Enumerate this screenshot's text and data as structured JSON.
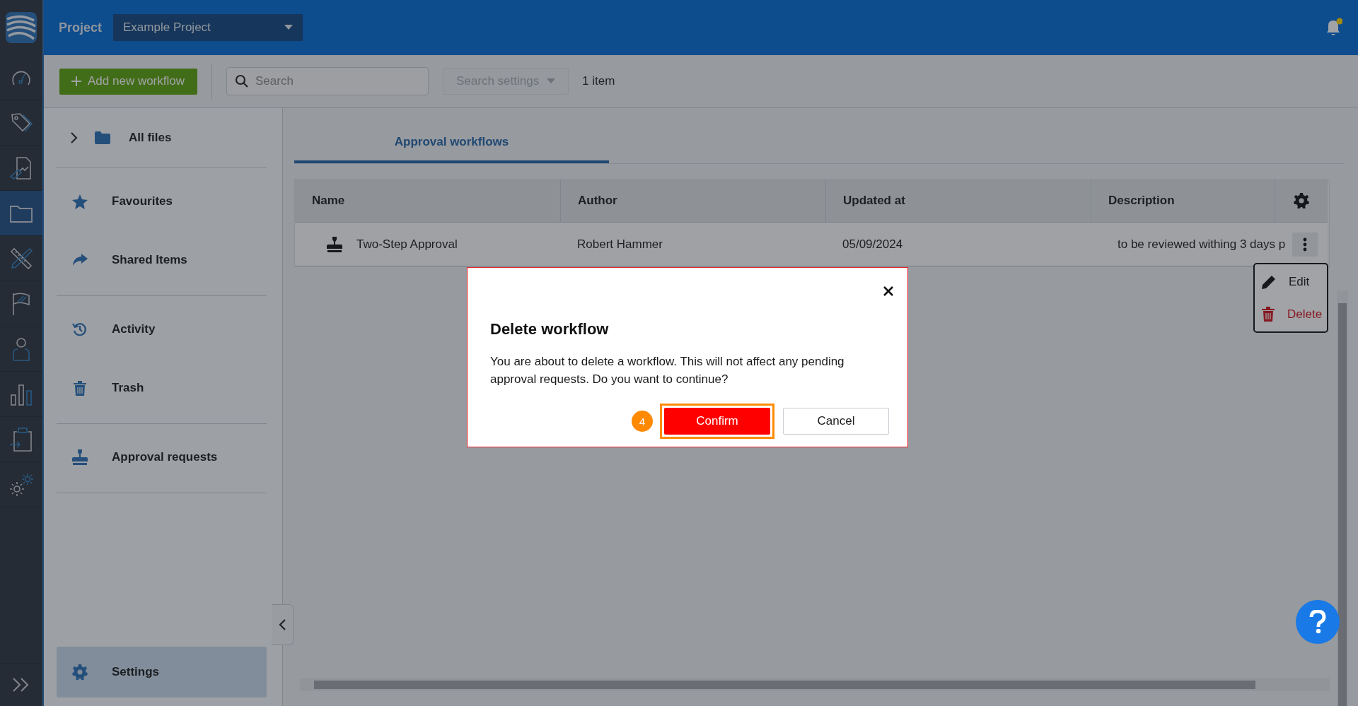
{
  "rail": {
    "items": [
      {
        "selected": false
      },
      {
        "selected": false
      },
      {
        "selected": false
      },
      {
        "selected": true
      },
      {
        "selected": false
      },
      {
        "selected": false
      },
      {
        "selected": false
      },
      {
        "selected": false
      },
      {
        "selected": false
      },
      {
        "selected": false
      }
    ]
  },
  "topbar": {
    "project_label": "Project",
    "project_select": {
      "value": "Example Project"
    },
    "notifications": {
      "unread": true
    }
  },
  "toolbar": {
    "add_button": "Add new workflow",
    "search": {
      "placeholder": "Search"
    },
    "search_settings": {
      "label": "Search settings",
      "disabled": true
    },
    "item_count": "1 item"
  },
  "sidebar": {
    "groups": [
      {
        "items": [
          {
            "label": "All files",
            "expanded": false,
            "selected": false
          }
        ]
      },
      {
        "items": [
          {
            "label": "Favourites",
            "selected": false
          },
          {
            "label": "Shared Items",
            "selected": false
          }
        ]
      },
      {
        "items": [
          {
            "label": "Activity",
            "selected": false
          },
          {
            "label": "Trash",
            "selected": false
          }
        ]
      },
      {
        "items": [
          {
            "label": "Approval requests",
            "selected": false
          }
        ]
      }
    ],
    "settings": {
      "label": "Settings",
      "selected": true
    }
  },
  "tabs": [
    {
      "label": "Approval workflows",
      "selected": true
    }
  ],
  "table": {
    "columns": [
      "Name",
      "Author",
      "Updated at",
      "Description"
    ],
    "rows": [
      {
        "name": "Two-Step Approval",
        "author": "Robert Hammer",
        "updated_at": "05/09/2024",
        "description": "to be reviewed withing 3 days p"
      }
    ]
  },
  "context_menu": {
    "items": [
      {
        "label": "Edit",
        "kind": "normal"
      },
      {
        "label": "Delete",
        "kind": "danger"
      }
    ]
  },
  "dialog": {
    "title": "Delete workflow",
    "message": "You are about to delete a workflow. This will not affect any pending approval requests. Do you want to continue?",
    "step_badge": "4",
    "buttons": [
      {
        "label": "Confirm",
        "kind": "primary",
        "highlighted": true
      },
      {
        "label": "Cancel",
        "kind": "secondary",
        "highlighted": false
      }
    ]
  }
}
